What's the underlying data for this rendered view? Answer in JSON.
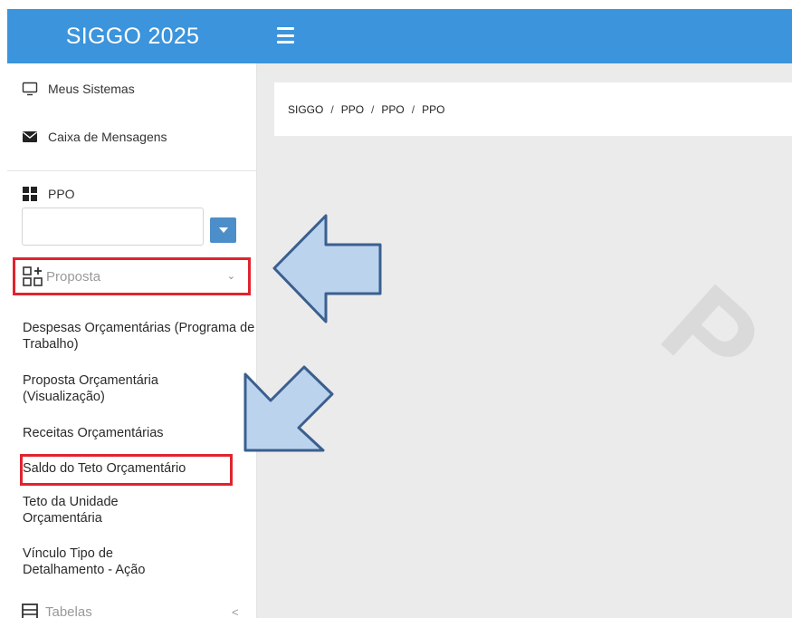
{
  "header": {
    "title": "SIGGO 2025",
    "menu_icon": "hamburger-icon",
    "color": "#3b94dc"
  },
  "sidebar": {
    "meus_sistemas": "Meus Sistemas",
    "caixa_mensagens": "Caixa de Mensagens",
    "ppo_label": "PPO",
    "ppo_select_value": "",
    "proposta_label": "Proposta",
    "links": [
      "Despesas Orçamentárias (Programa de Trabalho)",
      "Proposta Orçamentária (Visualização)",
      "Receitas Orçamentárias",
      "Saldo do Teto Orçamentário",
      "Teto da Unidade Orçamentária",
      "Vínculo Tipo de Detalhamento - Ação"
    ],
    "tabelas_label": "Tabelas"
  },
  "breadcrumb": [
    "SIGGO",
    "PPO",
    "PPO",
    "PPO"
  ],
  "watermark": "P",
  "colors": {
    "highlight": "#e0242e",
    "arrow_fill": "#bcd3ee",
    "arrow_stroke": "#3a5f8f"
  }
}
